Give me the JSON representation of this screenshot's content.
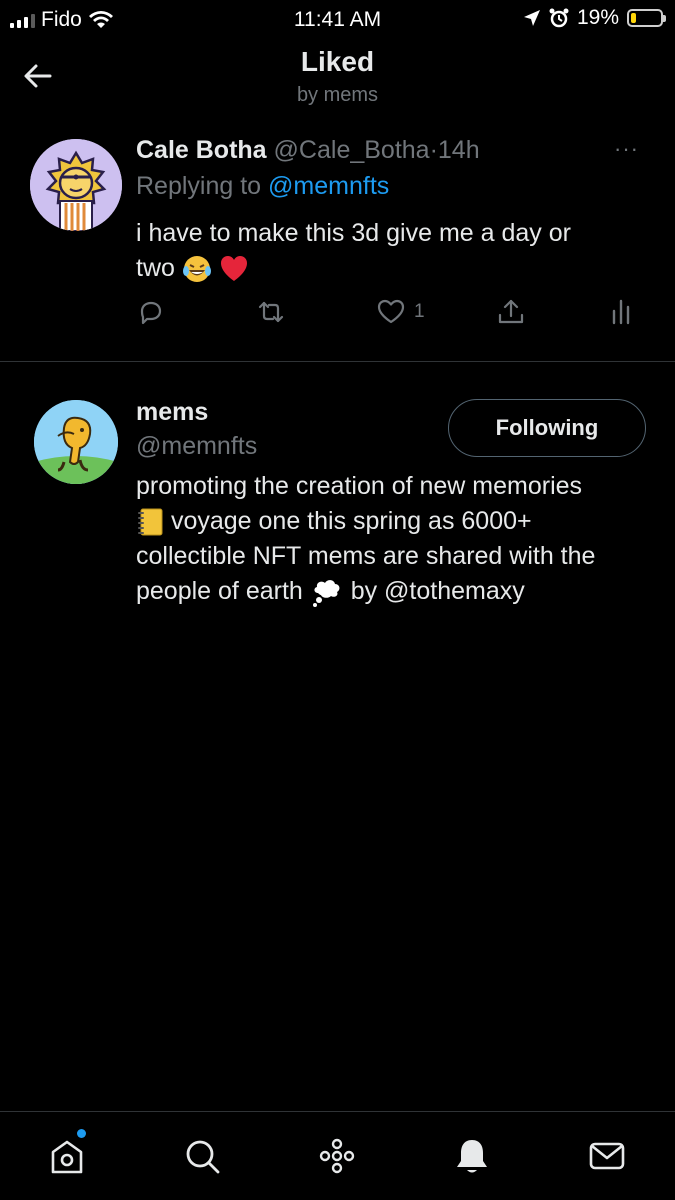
{
  "status_bar": {
    "carrier": "Fido",
    "time": "11:41 AM",
    "battery": "19%",
    "battery_level": 0.19
  },
  "header": {
    "title": "Liked",
    "subtitle": "by mems"
  },
  "tweet": {
    "name": "Cale Botha",
    "handle": "@Cale_Botha",
    "separator": "·",
    "time": "14h",
    "more": "···",
    "replying_prefix": "Replying to",
    "replying_to": "@memnfts",
    "text_line1": "i have to make this 3d give me a day or",
    "text_line2": "two",
    "like_count": "1"
  },
  "profile": {
    "name": "mems",
    "handle": "@memnfts",
    "follow_label": "Following",
    "bio_line1": "promoting the creation of new memories",
    "bio_line2": "voyage one this spring as 6000+",
    "bio_line3": "collectible NFT mems are shared with the",
    "bio_line4_a": "people of earth",
    "bio_line4_b": "by @tothemaxy"
  },
  "colors": {
    "accent": "#1d9bf0",
    "background": "#000000",
    "secondary_text": "#71767b"
  },
  "icons": [
    "back-arrow-icon",
    "more-icon",
    "reply-icon",
    "retweet-icon",
    "like-icon",
    "share-icon",
    "analytics-icon",
    "home-icon",
    "search-icon",
    "spaces-icon",
    "notifications-icon",
    "messages-icon"
  ]
}
